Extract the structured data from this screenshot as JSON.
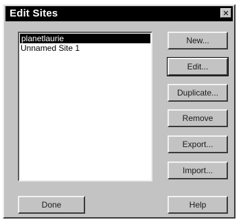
{
  "dialog": {
    "title": "Edit Sites",
    "close_glyph": "✕"
  },
  "site_list": {
    "items": [
      {
        "label": "planetlaurie",
        "selected": true
      },
      {
        "label": "Unnamed Site 1",
        "selected": false
      }
    ]
  },
  "buttons": {
    "new": "New...",
    "edit": "Edit...",
    "duplicate": "Duplicate...",
    "remove": "Remove",
    "export": "Export...",
    "import": "Import...",
    "done": "Done",
    "help": "Help"
  },
  "colors": {
    "title_bar": "#000000",
    "dialog_face": "#c3c3c3",
    "selection": "#000000"
  }
}
